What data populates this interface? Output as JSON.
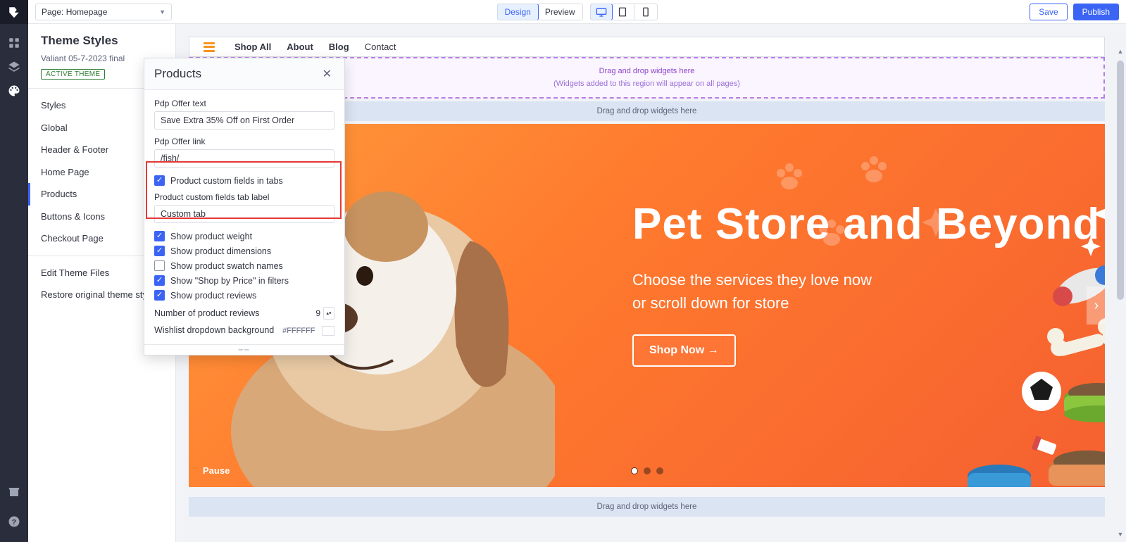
{
  "topbar": {
    "page_selector": "Page: Homepage",
    "design_label": "Design",
    "preview_label": "Preview",
    "save_label": "Save",
    "publish_label": "Publish"
  },
  "theme": {
    "title": "Theme Styles",
    "name": "Valiant 05-7-2023 final",
    "badge": "ACTIVE THEME",
    "menu": {
      "styles": "Styles",
      "global": "Global",
      "header_footer": "Header & Footer",
      "home_page": "Home Page",
      "products": "Products",
      "buttons_icons": "Buttons & Icons",
      "checkout_page": "Checkout Page",
      "edit_files": "Edit Theme Files",
      "restore": "Restore original theme styles"
    }
  },
  "settings": {
    "title": "Products",
    "pdp_offer_text_label": "Pdp Offer text",
    "pdp_offer_text_value": "Save Extra 35% Off on First Order",
    "pdp_offer_link_label": "Pdp Offer link",
    "pdp_offer_link_value": "/fish/",
    "custom_fields_tabs_label": "Product custom fields in tabs",
    "custom_fields_tab_label_label": "Product custom fields tab label",
    "custom_fields_tab_label_value": "Custom tab",
    "show_weight_label": "Show product weight",
    "show_dimensions_label": "Show product dimensions",
    "show_swatch_label": "Show product swatch names",
    "shop_by_price_label": "Show \"Shop by Price\" in filters",
    "show_reviews_label": "Show product reviews",
    "num_reviews_label": "Number of product reviews",
    "num_reviews_value": "9",
    "wishlist_bg_label": "Wishlist dropdown background",
    "wishlist_bg_value": "#FFFFFF"
  },
  "preview": {
    "nav": {
      "shop_all": "Shop All",
      "about": "About",
      "blog": "Blog",
      "contact": "Contact"
    },
    "global_region_line1": "Drag and drop widgets here",
    "global_region_line2": "(Widgets added to this region will appear on all pages)",
    "drop_bar": "Drag and drop widgets here",
    "drop_bar_bottom": "Drag and drop widgets here",
    "hero_title": "Pet Store and Beyond",
    "hero_sub": "Choose the services they love now or scroll down for store",
    "hero_cta": "Shop Now →",
    "pause": "Pause"
  }
}
